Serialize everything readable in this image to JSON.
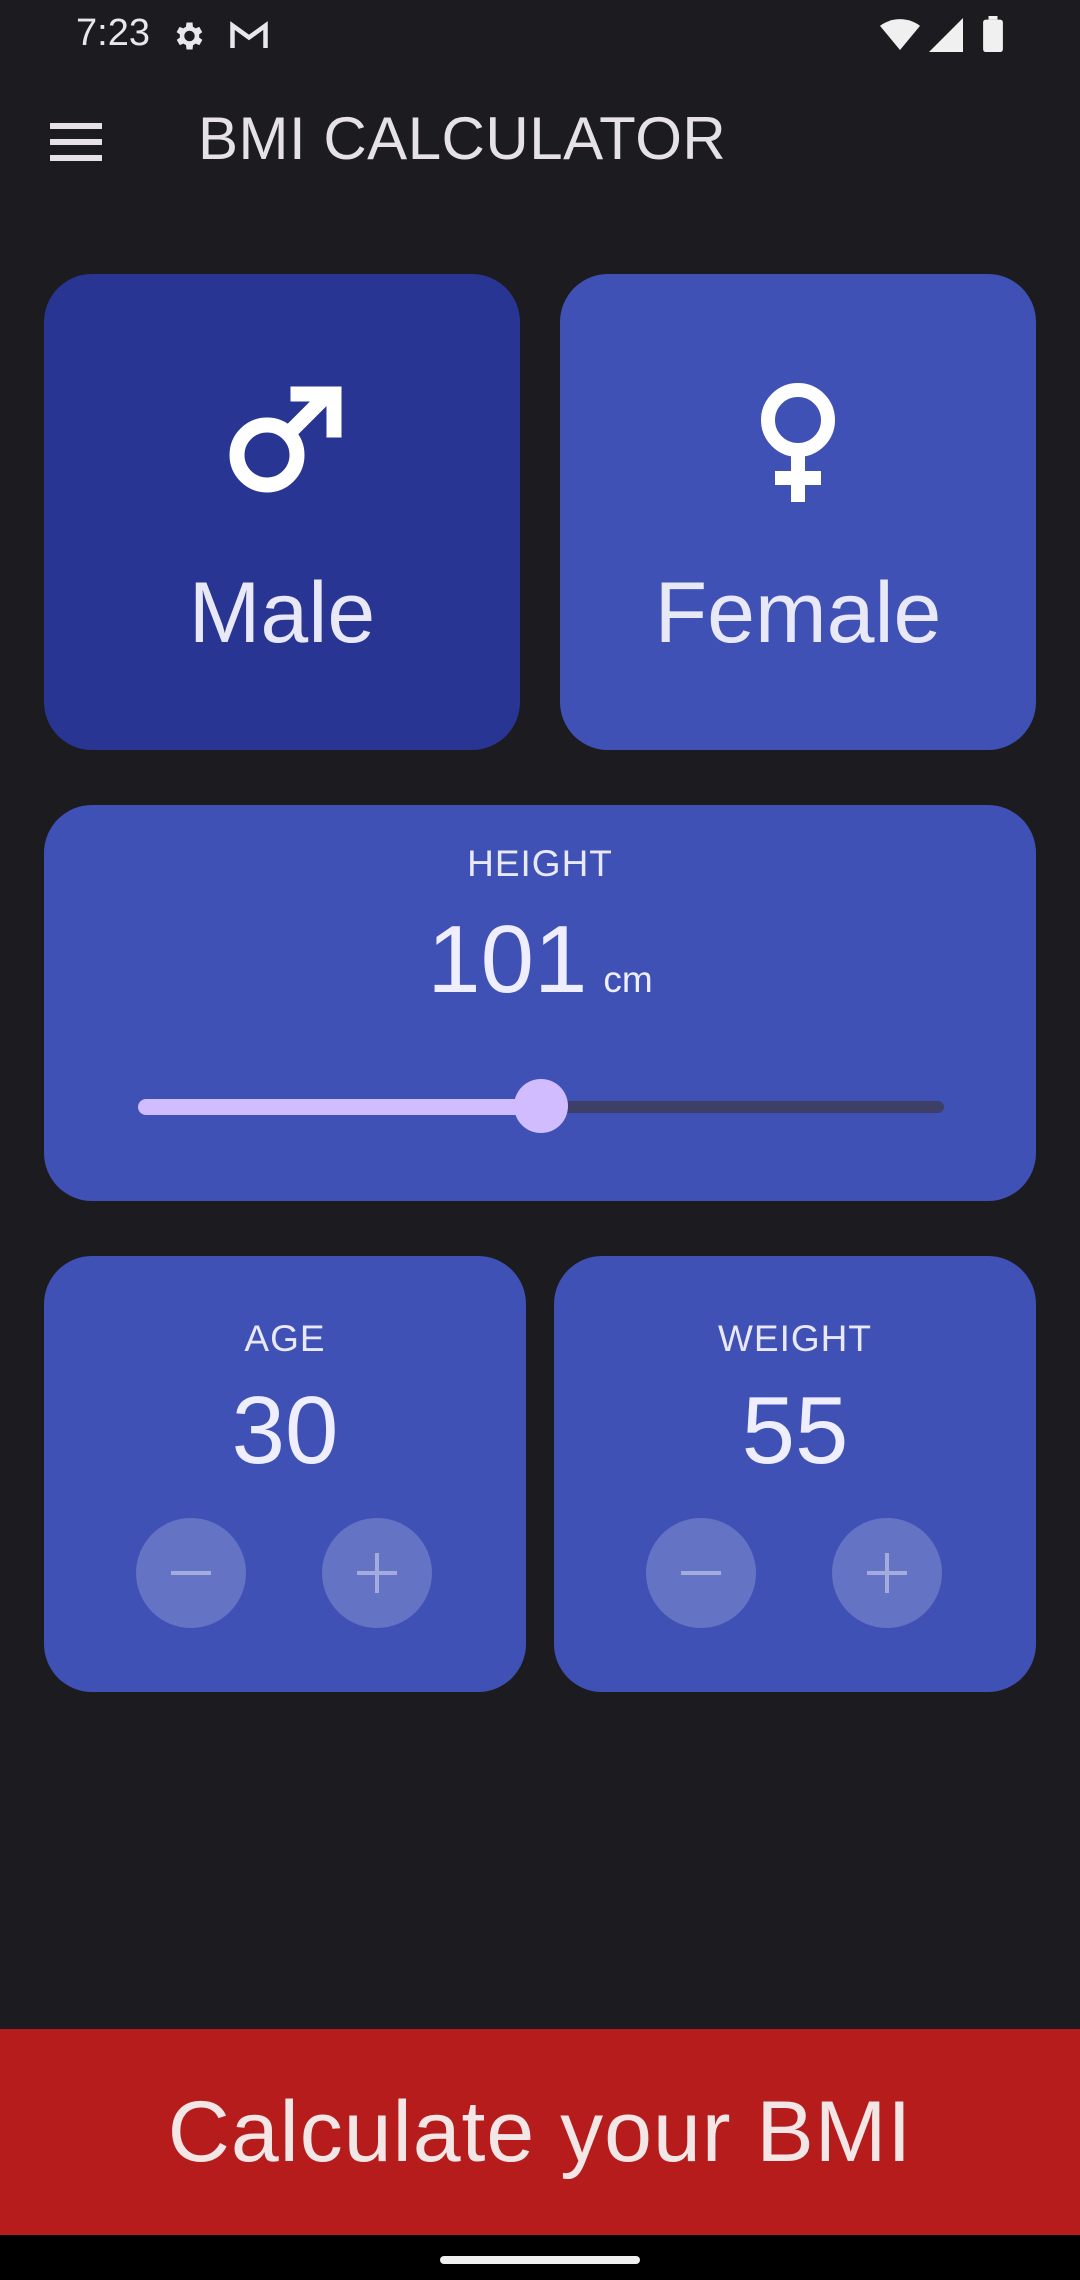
{
  "status_bar": {
    "time": "7:23",
    "icons": [
      "gear-icon",
      "gmail-icon",
      "wifi-icon",
      "signal-icon",
      "battery-icon"
    ]
  },
  "app_bar": {
    "title": "BMI CALCULATOR",
    "menu_icon": "hamburger-menu-icon"
  },
  "gender": {
    "male": {
      "label": "Male",
      "icon": "male-symbol-icon",
      "selected": true
    },
    "female": {
      "label": "Female",
      "icon": "female-symbol-icon",
      "selected": false
    }
  },
  "height": {
    "label": "HEIGHT",
    "value": "101",
    "unit": "cm",
    "slider_fraction": 0.5
  },
  "age": {
    "label": "AGE",
    "value": "30"
  },
  "weight": {
    "label": "WEIGHT",
    "value": "55"
  },
  "calculate_button": {
    "label": "Calculate your BMI"
  },
  "colors": {
    "background": "#1c1b20",
    "card": "#3f51b5",
    "card_selected": "#283593",
    "slider_active": "#d0bcff",
    "calculate_button": "#b71c1c"
  }
}
